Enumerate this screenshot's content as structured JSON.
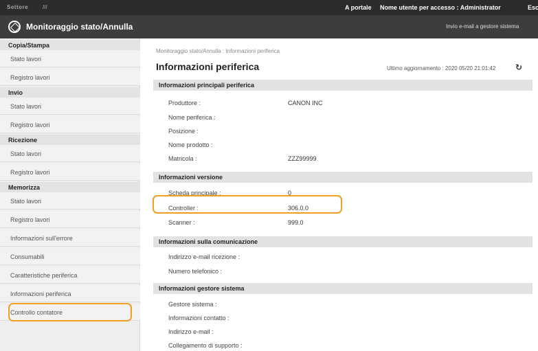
{
  "topbar": {
    "logo_text": "Settore",
    "logo_sub": "///",
    "portal_link": "A portale",
    "user_label": "Nome utente per accesso : Administrator",
    "logout_link": "Esc"
  },
  "titlebar": {
    "title": "Monitoraggio stato/Annulla",
    "mail_link": "Invio e-mail a gestore sistema"
  },
  "sidebar": {
    "sections": [
      {
        "title": "Copia/Stampa",
        "items": [
          "Stato lavori",
          "Registro lavori"
        ]
      },
      {
        "title": "Invio",
        "items": [
          "Stato lavori",
          "Registro lavori"
        ]
      },
      {
        "title": "Ricezione",
        "items": [
          "Stato lavori",
          "Registro lavori"
        ]
      },
      {
        "title": "Memorizza",
        "items": [
          "Stato lavori",
          "Registro lavori",
          "Informazioni sull'errore",
          "Consumabili",
          "Caratteristiche periferica",
          "Informazioni periferica",
          "Controllo contatore"
        ]
      }
    ],
    "selected_item": "Informazioni periferica"
  },
  "main": {
    "breadcrumb": "Monitoraggio stato/Annulla : Informazioni periferica",
    "title": "Informazioni periferica",
    "last_update": "Ultimo aggiornamento : 2020 05/20 21:01:42",
    "sections": [
      {
        "title": "Informazioni principali periferica",
        "rows": [
          {
            "label": "Produttore :",
            "value": "CANON INC"
          },
          {
            "label": "Nome periferica :",
            "value": ""
          },
          {
            "label": "Posizione :",
            "value": ""
          },
          {
            "label": "Nome prodotto :",
            "value": ""
          },
          {
            "label": "Matricola :",
            "value": "ZZZ99999"
          }
        ]
      },
      {
        "title": "Informazioni versione",
        "rows": [
          {
            "label": "Scheda principale :",
            "value": "0"
          },
          {
            "label": "Controller :",
            "value": "306.0.0"
          },
          {
            "label": "Scanner :",
            "value": "999.0"
          }
        ]
      },
      {
        "title": "Informazioni sulla comunicazione",
        "rows": [
          {
            "label": "Indirizzo e-mail ricezione :",
            "value": ""
          },
          {
            "label": "Numero telefonico :",
            "value": ""
          }
        ]
      },
      {
        "title": "Informazioni gestore sistema",
        "rows": [
          {
            "label": "Gestore sistema :",
            "value": ""
          },
          {
            "label": "Informazioni contatto :",
            "value": ""
          },
          {
            "label": "Indirizzo e-mail :",
            "value": ""
          },
          {
            "label": "Collegamento di supporto :",
            "value": ""
          }
        ]
      }
    ]
  },
  "colors": {
    "highlight": "#f0a020",
    "topbar": "#2c2c2c",
    "titlebar": "#3d3d3d",
    "section_header": "#e2e2e2"
  }
}
